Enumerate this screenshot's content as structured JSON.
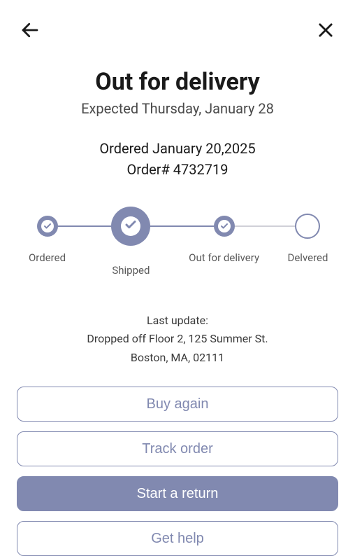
{
  "header": {
    "title": "Out for delivery",
    "expected": "Expected Thursday, January 28",
    "ordered_date": "Ordered January 20,2025",
    "order_number": "Order# 4732719"
  },
  "progress": {
    "steps": [
      {
        "label": "Ordered"
      },
      {
        "label": "Shipped"
      },
      {
        "label": "Out for delivery"
      },
      {
        "label": "Delvered"
      }
    ]
  },
  "update": {
    "heading": "Last update:",
    "line1": "Dropped off Floor 2, 125 Summer St.",
    "line2": "Boston, MA, 02111"
  },
  "actions": {
    "buy_again": "Buy again",
    "track_order": "Track order",
    "start_return": "Start a return",
    "get_help": "Get help"
  }
}
